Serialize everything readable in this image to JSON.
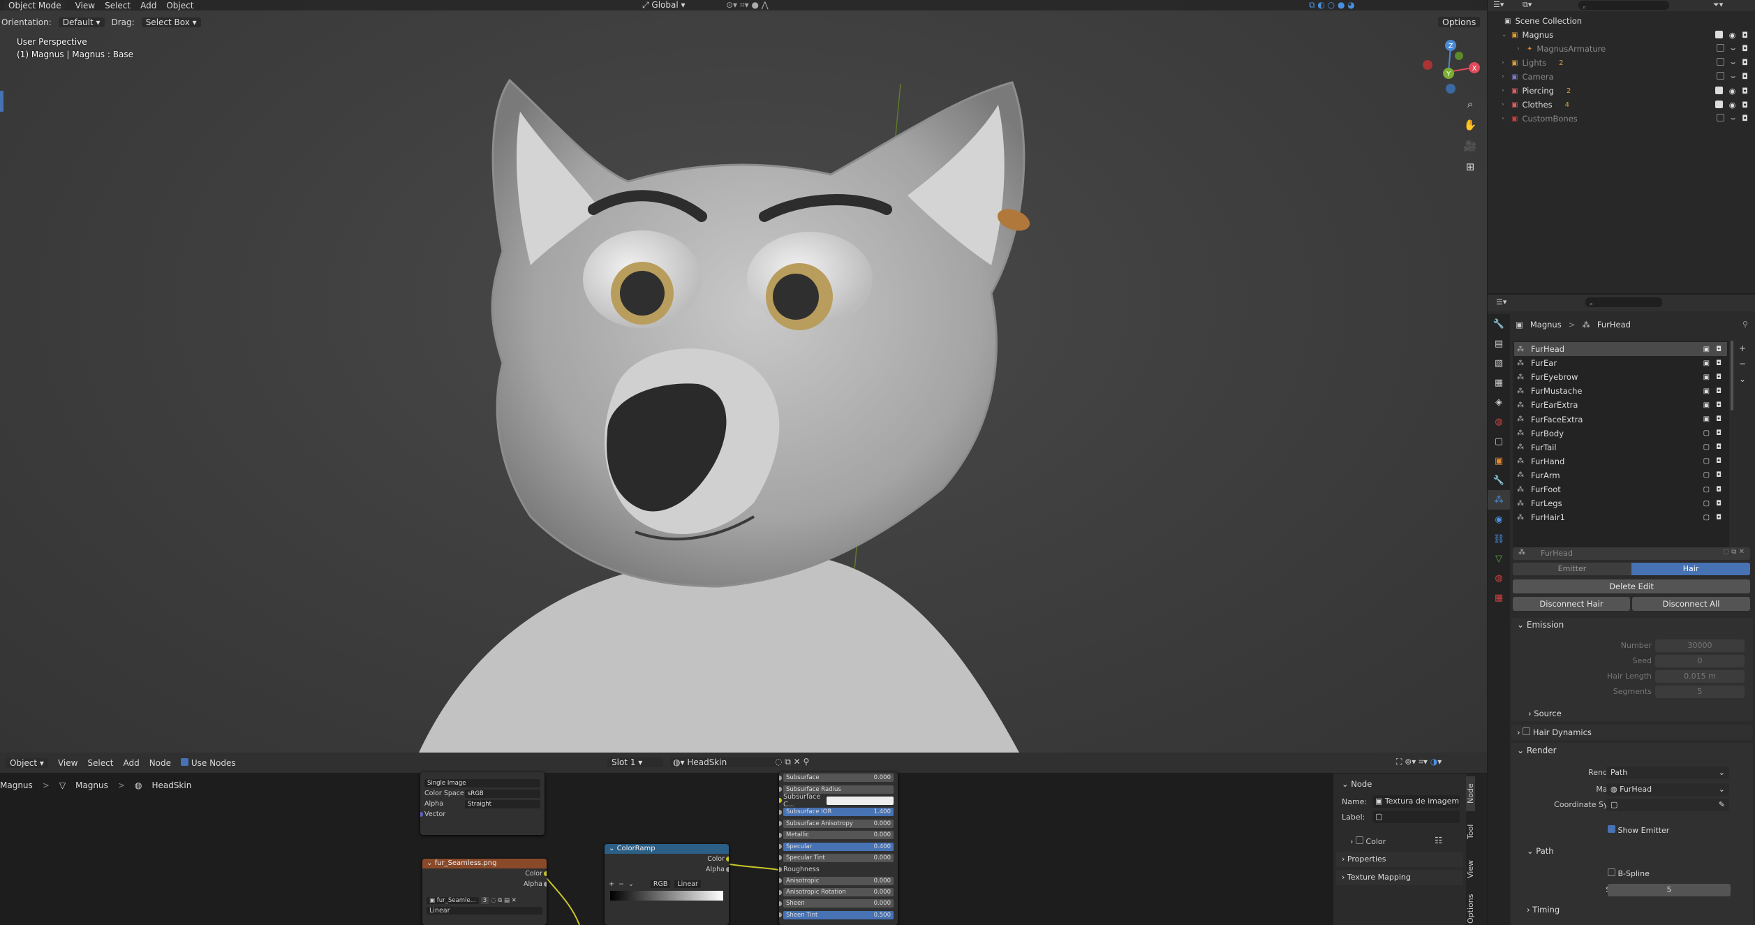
{
  "viewport": {
    "header": {
      "mode": "Object Mode",
      "menus": [
        "View",
        "Select",
        "Add",
        "Object"
      ],
      "transform": "Global",
      "options": "Options"
    },
    "tool": {
      "orientation_label": "Orientation:",
      "orientation": "Default",
      "drag_label": "Drag:",
      "drag": "Select Box"
    },
    "info": {
      "perspective": "User Perspective",
      "object": "(1) Magnus | Magnus : Base"
    },
    "gizmo": {
      "x": "X",
      "y": "Y",
      "z": "Z"
    }
  },
  "outliner": {
    "search_placeholder": "",
    "root": "Scene Collection",
    "items": [
      {
        "label": "Magnus",
        "dim": false,
        "badge": ""
      },
      {
        "label": "MagnusArmature",
        "dim": true,
        "badge": ""
      },
      {
        "label": "Lights",
        "dim": true,
        "badge": "2"
      },
      {
        "label": "Camera",
        "dim": true,
        "badge": ""
      },
      {
        "label": "Piercing",
        "dim": false,
        "badge": "2"
      },
      {
        "label": "Clothes",
        "dim": false,
        "badge": "4"
      },
      {
        "label": "CustomBones",
        "dim": true,
        "badge": ""
      }
    ]
  },
  "properties": {
    "breadcrumb": {
      "object": "Magnus",
      "system": "FurHead"
    },
    "particle_list": [
      "FurHead",
      "FurEar",
      "FurEyebrow",
      "FurMustache",
      "FurEarExtra",
      "FurFaceExtra",
      "FurBody",
      "FurTail",
      "FurHand",
      "FurArm",
      "FurFoot",
      "FurLegs",
      "FurHair1"
    ],
    "settings_name": "FurHead",
    "type_tabs": [
      "Emitter",
      "Hair"
    ],
    "buttons": {
      "delete_edit": "Delete Edit",
      "disconnect_hair": "Disconnect Hair",
      "disconnect_all": "Disconnect All"
    },
    "emission": {
      "title": "Emission",
      "number_label": "Number",
      "number": "30000",
      "seed_label": "Seed",
      "seed": "0",
      "hair_length_label": "Hair Length",
      "hair_length": "0.015 m",
      "segments_label": "Segments",
      "segments": "5",
      "source": "Source"
    },
    "hair_dynamics": "Hair Dynamics",
    "render": {
      "title": "Render",
      "render_as_label": "Render As",
      "render_as": "Path",
      "material_label": "Material",
      "material": "FurHead",
      "coord_label": "Coordinate System",
      "show_emitter": "Show Emitter",
      "path": "Path",
      "bspline": "B-Spline",
      "steps_label": "Steps",
      "steps": "5"
    },
    "timing": "Timing"
  },
  "node_editor": {
    "header": {
      "type": "Object",
      "menus": [
        "View",
        "Select",
        "Add",
        "Node"
      ],
      "use_nodes": "Use Nodes",
      "slot": "Slot 1",
      "material": "HeadSkin"
    },
    "breadcrumb": [
      "Magnus",
      "Magnus",
      "HeadSkin"
    ],
    "image_settings": {
      "rows": [
        [
          "Single Image",
          ""
        ],
        [
          "Color Space",
          "sRGB"
        ],
        [
          "Alpha",
          "Straight"
        ]
      ],
      "vector": "Vector"
    },
    "image_node": {
      "title": "fur_Seamless.png",
      "outputs": [
        "Color",
        "Alpha"
      ],
      "file": "fur_Seamle...",
      "users": "3",
      "interp": "Linear"
    },
    "color_ramp": {
      "title": "ColorRamp",
      "outputs": [
        "Color",
        "Alpha"
      ],
      "mode": "RGB",
      "interp": "Linear"
    },
    "bsdf_rows": [
      {
        "label": "Subsurface",
        "value": "0.000",
        "hl": false
      },
      {
        "label": "Subsurface Radius",
        "value": "",
        "hl": false
      },
      {
        "label": "Subsurface C...",
        "value": "",
        "hl": false
      },
      {
        "label": "Subsurface IOR",
        "value": "1.400",
        "hl": true
      },
      {
        "label": "Subsurface Anisotropy",
        "value": "0.000",
        "hl": false
      },
      {
        "label": "Metallic",
        "value": "0.000",
        "hl": false
      },
      {
        "label": "Specular",
        "value": "0.400",
        "hl": true
      },
      {
        "label": "Specular Tint",
        "value": "0.000",
        "hl": false
      },
      {
        "label": "Roughness",
        "value": "",
        "hl": false
      },
      {
        "label": "Anisotropic",
        "value": "0.000",
        "hl": false
      },
      {
        "label": "Anisotropic Rotation",
        "value": "0.000",
        "hl": false
      },
      {
        "label": "Sheen",
        "value": "0.000",
        "hl": false
      },
      {
        "label": "Sheen Tint",
        "value": "0.500",
        "hl": true
      }
    ],
    "npanel": {
      "section": "Node",
      "name_label": "Name:",
      "name": "Textura de imagem",
      "label_label": "Label:",
      "color": "Color",
      "properties": "Properties",
      "texture_mapping": "Texture Mapping"
    },
    "tabs": [
      "Node",
      "Tool",
      "View",
      "Options"
    ]
  }
}
